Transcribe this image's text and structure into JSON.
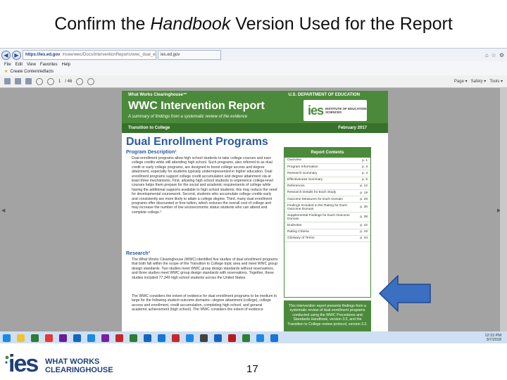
{
  "slide": {
    "title_pre": "Confirm the ",
    "title_em": "Handbook",
    "title_post": " Version Used for the Report",
    "page_number": "17"
  },
  "browser": {
    "url_host": "https://ies.ed.gov",
    "url_path": "/ncee/wwc/Docs/InterventionReports/wwc_dual_en...",
    "tab_label": "ies.ed.gov",
    "menu": [
      "File",
      "Edit",
      "View",
      "Favorites",
      "Help"
    ],
    "favorites_label": "Create Content/edfacts",
    "pdf_page": "1",
    "pdf_pages_total": "/ 46",
    "right_menu": [
      "Page ▾",
      "Safety ▾",
      "Tools ▾"
    ]
  },
  "report": {
    "clearinghouse": "What Works Clearinghouse™",
    "department": "U.S. DEPARTMENT OF EDUCATION",
    "header_title": "WWC Intervention Report",
    "header_subtitle": "A summary of findings from a systematic review of the evidence",
    "ies_logo": "ies",
    "ies_name": "INSTITUTE OF EDUCATION SCIENCES",
    "topic": "Transition to College",
    "date": "February 2017",
    "title": "Dual Enrollment Programs",
    "program_heading": "Program Description¹",
    "program_text": "Dual enrollment programs allow high school students to take college courses and earn college credits while still attending high school. Such programs, also referred to as dual credit or early college programs, are designed to boost college access and degree attainment, especially for students typically underrepresented in higher education. Dual enrollment programs support college credit accumulation and degree attainment via at least three mechanisms. First, allowing high school students to experience college-level courses helps them prepare for the social and academic requirements of college while having the additional supports available to high school students; this may reduce the need for developmental coursework. Second, students who accumulate college credits early and consistently are more likely to attain a college degree. Third, many dual enrollment programs offer discounted or free tuition, which reduces the overall cost of college and may increase the number of low socioeconomic status students who can attend and complete college.²",
    "research_heading": "Research³",
    "research_text": "The What Works Clearinghouse (WWC) identified five studies of dual enrollment programs that both fall within the scope of the Transition to College topic area and meet WWC group design standards. Two studies meet WWC group design standards without reservations, and three studies meet WWC group design standards with reservations. Together, these studies included 77,349 high school students across the United States.",
    "research_text2": "The WWC considers the extent of evidence for dual enrollment programs to be medium to large for the following student outcome domains—degree attainment (college), college access and enrollment, credit accumulation, completing high school, and general academic achievement (high school). The WWC considers the extent of evidence",
    "contents_heading": "Report Contents",
    "contents": [
      {
        "label": "Overview",
        "page": "p. 1"
      },
      {
        "label": "Program Information",
        "page": "p. 3"
      },
      {
        "label": "Research Summary",
        "page": "p. 4"
      },
      {
        "label": "Effectiveness Summary",
        "page": "p. 6"
      },
      {
        "label": "References",
        "page": "p. 12"
      },
      {
        "label": "Research Details for Each Study",
        "page": "p. 19"
      },
      {
        "label": "Outcome Measures for Each Domain",
        "page": "p. 28"
      },
      {
        "label": "Findings Included in the Rating for Each Outcome Domain",
        "page": "p. 30"
      },
      {
        "label": "Supplemental Findings for Each Outcome Domain",
        "page": "p. 38"
      },
      {
        "label": "Endnotes",
        "page": "p. 42"
      },
      {
        "label": "Rating Criteria",
        "page": "p. 43"
      },
      {
        "label": "Glossary of Terms",
        "page": "p. 44"
      }
    ],
    "note": "This intervention report presents findings from a systematic review of dual enrollment programs conducted using the WWC Procedures and Standards Handbook, version 3.0, and the Transition to College review protocol, version 3.2."
  },
  "taskbar": {
    "time": "12:15 PM",
    "date": "3/7/2018",
    "icon_colors": [
      "#1e88e5",
      "#f2c230",
      "#2e7d32",
      "#e53935",
      "#6a1b9a",
      "#1565c0",
      "#1e88e5",
      "#7b1fa2",
      "#c62828",
      "#2e7d32",
      "#1565c0",
      "#1976d2",
      "#c62828",
      "#1e88e5",
      "#424242",
      "#1565c0",
      "#b71c1c",
      "#2e7d32",
      "#1e88e5",
      "#1976d2"
    ]
  },
  "footer": {
    "logo_ies": "ies",
    "logo_line1": "WHAT WORKS",
    "logo_line2": "CLEARINGHOUSE"
  },
  "colors": {
    "wwc_green": "#4b8a3a",
    "report_blue": "#2b5aa0",
    "arrow_blue": "#3a6fc2",
    "ies_navy": "#1f3f7a"
  }
}
